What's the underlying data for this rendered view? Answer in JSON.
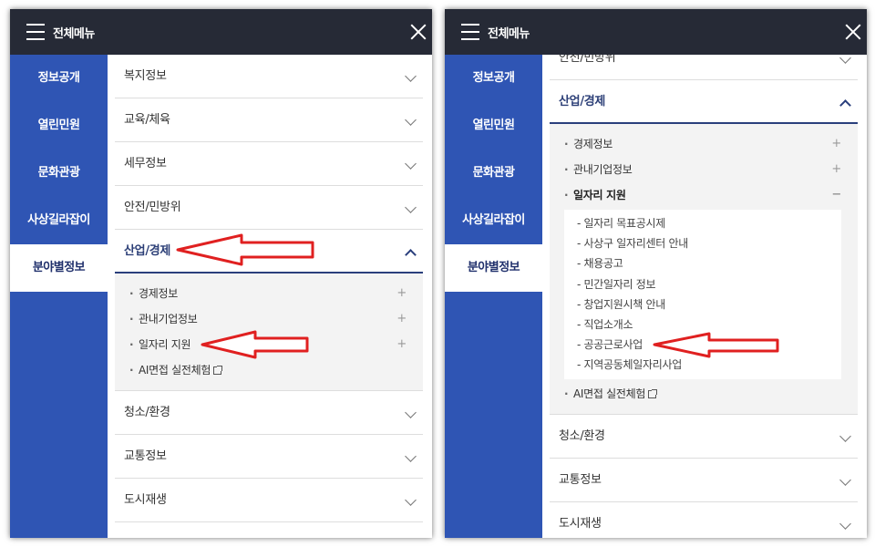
{
  "header": {
    "title": "전체메뉴"
  },
  "sidebar": {
    "items": [
      {
        "label": "정보공개"
      },
      {
        "label": "열린민원"
      },
      {
        "label": "문화관광"
      },
      {
        "label": "사상길라잡이"
      },
      {
        "label": "분야별정보"
      }
    ]
  },
  "left_panel": {
    "rows_top": [
      {
        "label": "복지정보"
      },
      {
        "label": "교육/체육"
      },
      {
        "label": "세무정보"
      },
      {
        "label": "안전/민방위"
      }
    ],
    "open_row": {
      "label": "산업/경제"
    },
    "sub_items": [
      {
        "label": "경제정보",
        "toggle": "+"
      },
      {
        "label": "관내기업정보",
        "toggle": "+"
      },
      {
        "label": "일자리 지원",
        "toggle": "+"
      },
      {
        "label": "AI면접 실전체험"
      }
    ],
    "rows_bottom": [
      {
        "label": "청소/환경"
      },
      {
        "label": "교통정보"
      },
      {
        "label": "도시재생"
      }
    ]
  },
  "right_panel": {
    "rows_top": [
      {
        "label": "안전/민방위"
      }
    ],
    "open_row": {
      "label": "산업/경제"
    },
    "sub_items": [
      {
        "label": "경제정보",
        "toggle": "+"
      },
      {
        "label": "관내기업정보",
        "toggle": "+"
      },
      {
        "label": "일자리 지원",
        "toggle": "−"
      }
    ],
    "sub2_items": [
      {
        "label": "- 일자리 목표공시제"
      },
      {
        "label": "- 사상구 일자리센터 안내"
      },
      {
        "label": "- 채용공고"
      },
      {
        "label": "- 민간일자리 정보"
      },
      {
        "label": "- 창업지원시책 안내"
      },
      {
        "label": "- 직업소개소"
      },
      {
        "label": "- 공공근로사업"
      },
      {
        "label": "- 지역공동체일자리사업"
      }
    ],
    "sub_after": {
      "label": "AI면접 실전체험"
    },
    "rows_bottom": [
      {
        "label": "청소/환경"
      },
      {
        "label": "교통정보"
      },
      {
        "label": "도시재생"
      }
    ]
  },
  "colors": {
    "topbar": "#262a36",
    "sidebar": "#2f55b4",
    "accent": "#2a3f7c",
    "arrow": "#e02020"
  }
}
